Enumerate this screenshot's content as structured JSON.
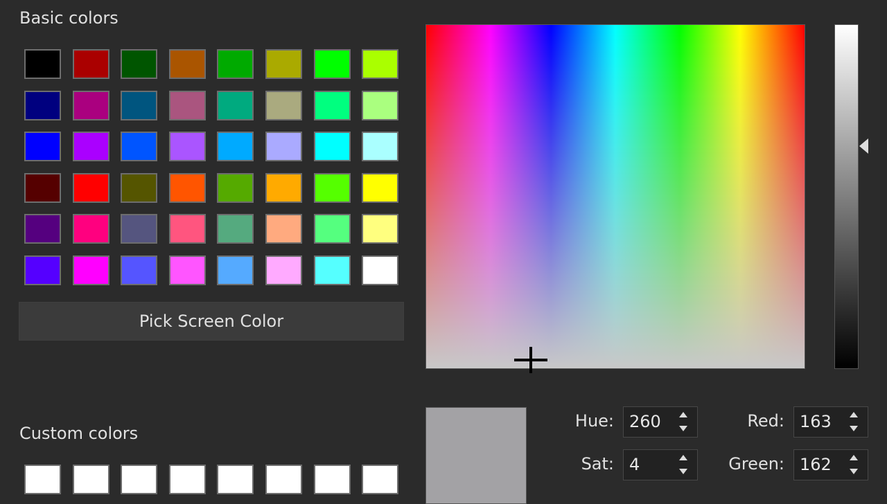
{
  "labels": {
    "basic_colors": "Basic colors",
    "custom_colors": "Custom colors",
    "pick_screen_color": "Pick Screen Color"
  },
  "basic_colors": [
    "#000000",
    "#aa0000",
    "#005500",
    "#aa5500",
    "#00aa00",
    "#aaaa00",
    "#00ff00",
    "#aaff00",
    "#00007f",
    "#aa007f",
    "#00557f",
    "#aa557f",
    "#00aa7f",
    "#aaaa7f",
    "#00ff7f",
    "#aaff7f",
    "#0000ff",
    "#aa00ff",
    "#0055ff",
    "#aa55ff",
    "#00aaff",
    "#aaaaff",
    "#00ffff",
    "#aaffff",
    "#550000",
    "#ff0000",
    "#555500",
    "#ff5500",
    "#55aa00",
    "#ffaa00",
    "#55ff00",
    "#ffff00",
    "#55007f",
    "#ff007f",
    "#55557f",
    "#ff557f",
    "#55aa7f",
    "#ffaa7f",
    "#55ff7f",
    "#ffff7f",
    "#5500ff",
    "#ff00ff",
    "#5555ff",
    "#ff55ff",
    "#55aaff",
    "#ffaaff",
    "#55ffff",
    "#ffffff"
  ],
  "custom_colors": [
    "#ffffff",
    "#ffffff",
    "#ffffff",
    "#ffffff",
    "#ffffff",
    "#ffffff",
    "#ffffff",
    "#ffffff"
  ],
  "current_color": "#a3a2a5",
  "fields": {
    "hue": {
      "label": "Hue:",
      "value": "260"
    },
    "sat": {
      "label": "Sat:",
      "value": "4"
    },
    "red": {
      "label": "Red:",
      "value": "163"
    },
    "green": {
      "label": "Green:",
      "value": "162"
    }
  },
  "icons": {
    "crosshair": "crosshair-icon",
    "slider_arrow": "triangle-left-icon",
    "spin_up": "triangle-up-icon",
    "spin_down": "triangle-down-icon"
  }
}
